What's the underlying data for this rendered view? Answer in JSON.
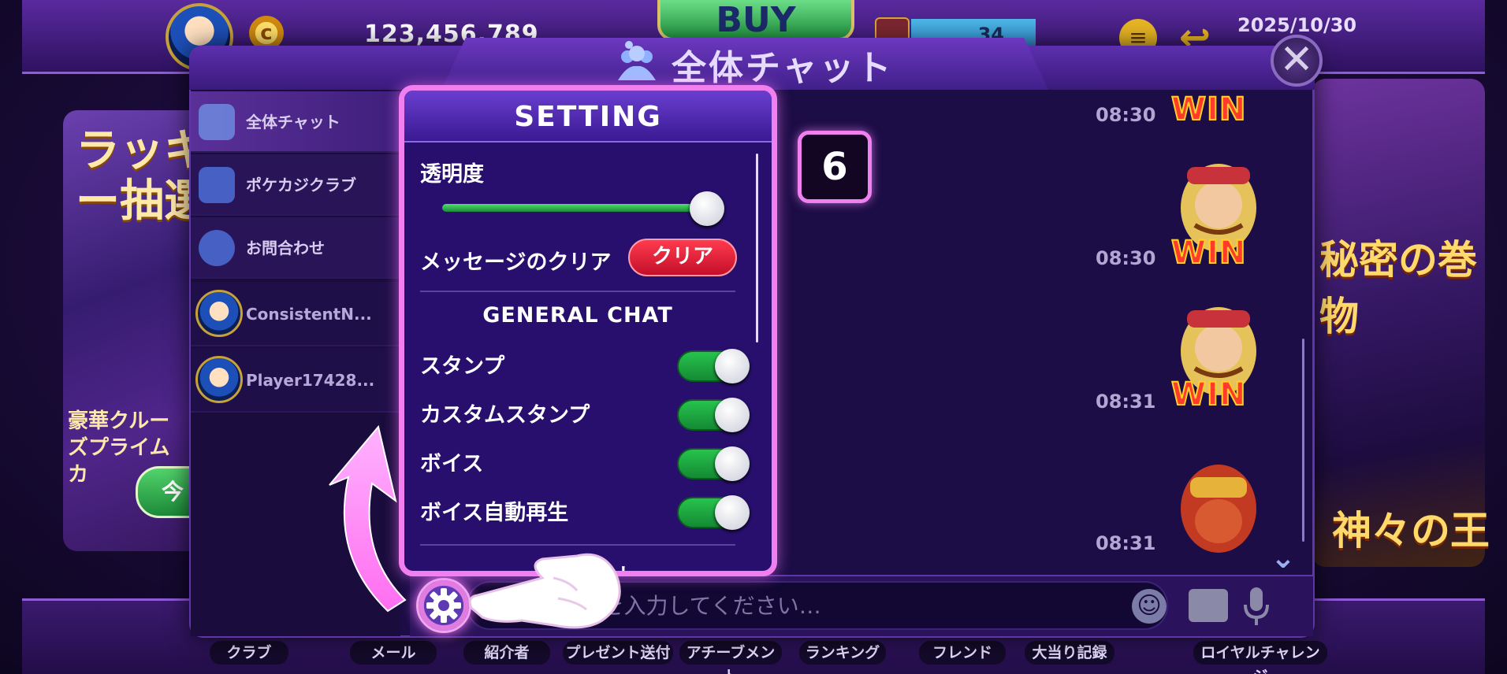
{
  "topbar": {
    "coin_symbol": "c",
    "coins": "123,456,789",
    "buy_label": "BUY",
    "ticket_count": "34",
    "date": "2025/10/30"
  },
  "banners": {
    "left_title": "ラッキー抽選",
    "left_subtitle": "豪華クルーズプライムカ",
    "left_button": "今",
    "right_title_1": "秘密の巻物",
    "right_title_2": "神々の王"
  },
  "chat_modal": {
    "title": "全体チャット",
    "close_label": "✕",
    "tabs": [
      {
        "label": "全体チャット",
        "icon": "people-icon",
        "active": true
      },
      {
        "label": "ポケカジクラブ",
        "icon": "star-shield-icon",
        "active": false
      },
      {
        "label": "お問合わせ",
        "icon": "headset-icon",
        "active": false
      }
    ],
    "conversations": [
      {
        "name": "ConsistentN..."
      },
      {
        "name": "Player17428..."
      }
    ],
    "messages": [
      {
        "time": "08:30",
        "sticker": "WIN"
      },
      {
        "time": "08:30",
        "sticker": "WIN"
      },
      {
        "time": "08:31",
        "sticker": "WIN"
      },
      {
        "time": "08:31",
        "sticker": ""
      }
    ],
    "input_placeholder": "メッセージを入力してください…",
    "visible_input_text": "ージを入力してください…"
  },
  "settings": {
    "title": "SETTING",
    "opacity_label": "透明度",
    "opacity_value": 1.0,
    "clear_label": "メッセージのクリア",
    "clear_button": "クリア",
    "section_title": "GENERAL CHAT",
    "toggles": [
      {
        "label": "スタンプ",
        "on": true
      },
      {
        "label": "カスタムスタンプ",
        "on": true
      },
      {
        "label": "ボイス",
        "on": true
      },
      {
        "label": "ボイス自動再生",
        "on": true
      }
    ],
    "partial_next_label": "ット"
  },
  "tutorial": {
    "step_number": "6"
  },
  "bottom_nav": [
    {
      "label": "クラブ"
    },
    {
      "label": "メール"
    },
    {
      "label": "紹介者"
    },
    {
      "label": "プレゼント送付"
    },
    {
      "label": "アチーブメント"
    },
    {
      "label": "ランキング"
    },
    {
      "label": "フレンド"
    },
    {
      "label": "大当り記録"
    },
    {
      "label": "ロイヤルチャレンジ"
    }
  ],
  "colors": {
    "accent_pink": "#f27ff0",
    "toggle_on": "#27c34d",
    "clear_red": "#e0203a",
    "panel_purple": "#280f6e"
  }
}
